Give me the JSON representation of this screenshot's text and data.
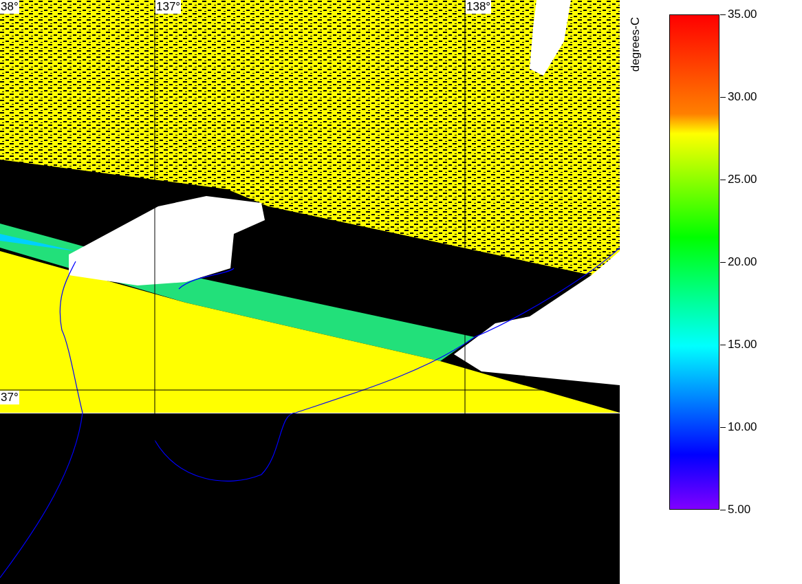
{
  "map": {
    "grid_labels": [
      "38°",
      "137°",
      "138°",
      "37°"
    ]
  },
  "color_scale": {
    "title": "degrees-C",
    "ticks": [
      "35.00",
      "30.00",
      "25.00",
      "20.00",
      "15.00",
      "10.00",
      "5.00"
    ]
  }
}
